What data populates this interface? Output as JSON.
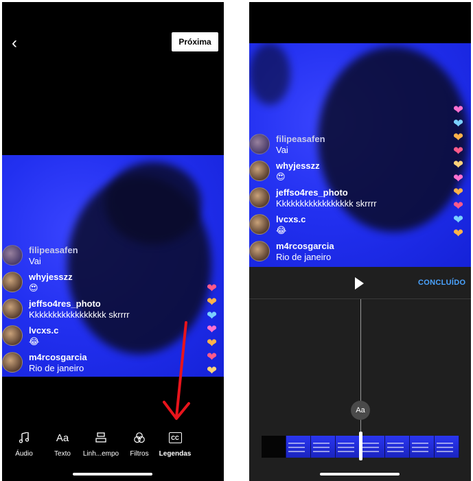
{
  "left_screen": {
    "next_label": "Próxima",
    "comments": [
      {
        "user": "filipeasafen",
        "text": "Vai"
      },
      {
        "user": "whyjesszz",
        "text": "😍"
      },
      {
        "user": "jeffso4res_photo",
        "text": "Kkkkkkkkkkkkkkkkk skrrrr"
      },
      {
        "user": "lvcxs.c",
        "text": "😂"
      },
      {
        "user": "m4rcosgarcia",
        "text": "Rio de janeiro"
      }
    ],
    "toolbar": [
      {
        "label": "Áudio",
        "icon": "music-note-icon"
      },
      {
        "label": "Texto",
        "icon": "text-aa-icon",
        "glyph": "Aa"
      },
      {
        "label": "Linh...empo",
        "icon": "timeline-icon"
      },
      {
        "label": "Filtros",
        "icon": "filters-icon"
      },
      {
        "label": "Legendas",
        "icon": "captions-cc-icon",
        "glyph": "CC"
      }
    ]
  },
  "right_screen": {
    "done_label": "CONCLUÍDO",
    "aa_label": "Aa",
    "comments": [
      {
        "user": "filipeasafen",
        "text": "Vai"
      },
      {
        "user": "whyjesszz",
        "text": "😍"
      },
      {
        "user": "jeffso4res_photo",
        "text": "Kkkkkkkkkkkkkkkkk skrrrr"
      },
      {
        "user": "lvcxs.c",
        "text": "😂"
      },
      {
        "user": "m4rcosgarcia",
        "text": "Rio de janeiro"
      }
    ]
  },
  "colors": {
    "video_blue": "#2230f0",
    "accent_blue": "#4aa3ff",
    "arrow_red": "#e8141c",
    "editor_bg": "#1f1f1f"
  }
}
